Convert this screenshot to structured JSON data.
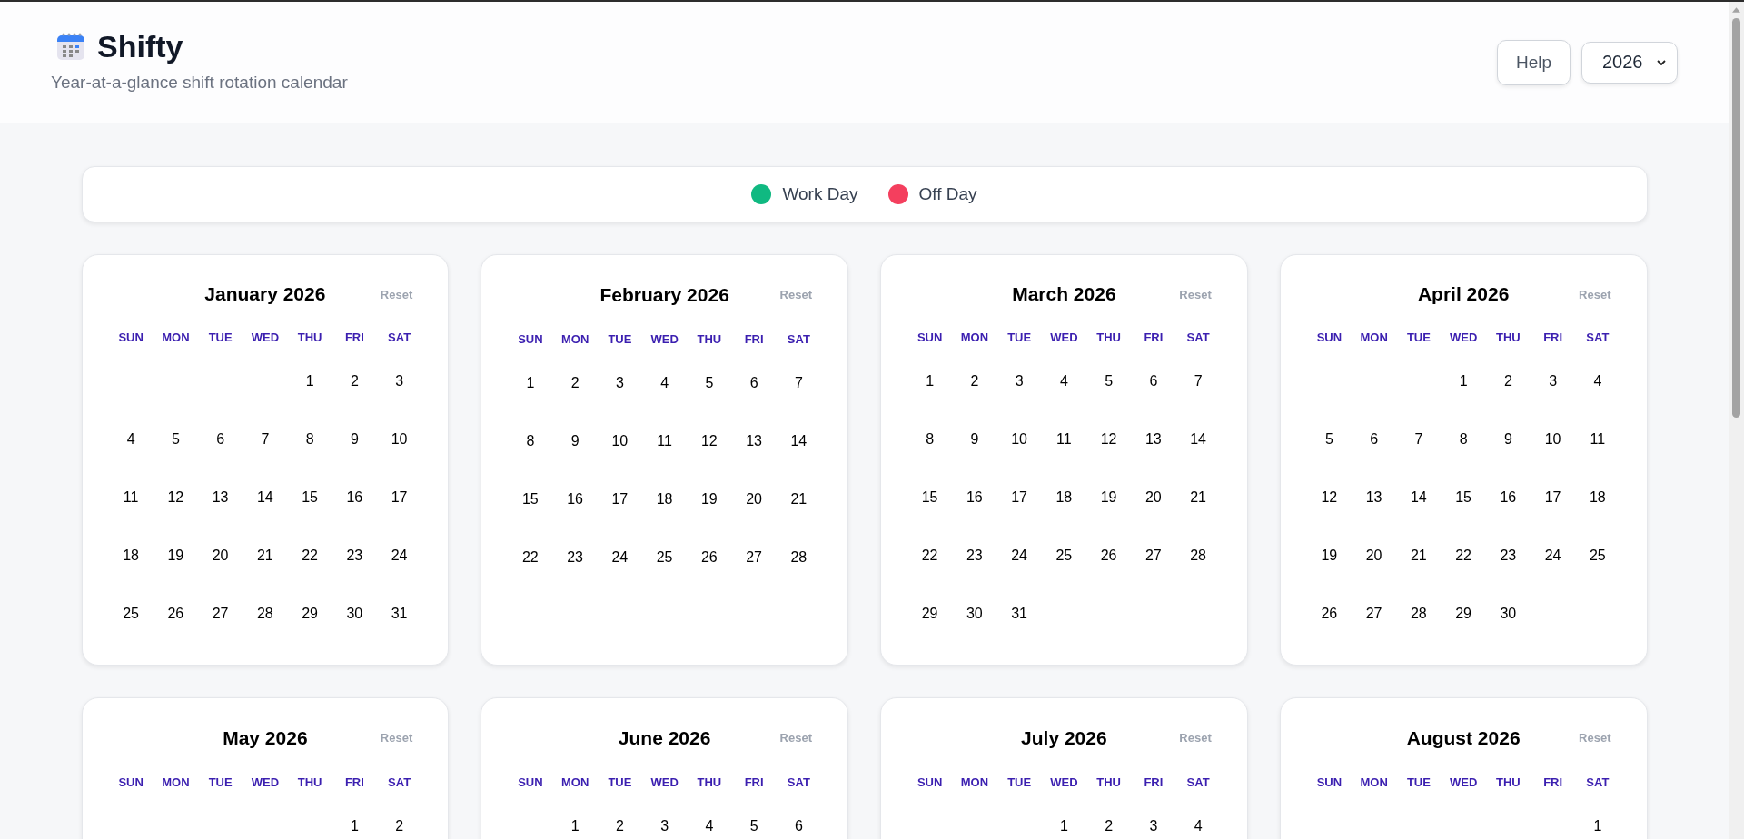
{
  "header": {
    "title": "Shifty",
    "subtitle": "Year-at-a-glance shift rotation calendar",
    "help_button": "Help",
    "year_select": {
      "value": "2026"
    }
  },
  "legend": [
    {
      "label": "Work Day",
      "color": "#10b981"
    },
    {
      "label": "Off Day",
      "color": "#f43f5e"
    }
  ],
  "months": [
    {
      "title": "January 2026",
      "reset": "Reset",
      "weekdays": [
        "SUN",
        "MON",
        "TUE",
        "WED",
        "THU",
        "FRI",
        "SAT"
      ],
      "weeks": [
        [
          {
            "kind": "blank"
          },
          {
            "kind": "blank"
          },
          {
            "kind": "blank"
          },
          {
            "kind": "blank"
          },
          {
            "kind": "day",
            "label": "1"
          },
          {
            "kind": "day",
            "label": "2"
          },
          {
            "kind": "day",
            "label": "3"
          }
        ],
        [
          {
            "kind": "day",
            "label": "4"
          },
          {
            "kind": "day",
            "label": "5"
          },
          {
            "kind": "day",
            "label": "6"
          },
          {
            "kind": "day",
            "label": "7"
          },
          {
            "kind": "day",
            "label": "8"
          },
          {
            "kind": "day",
            "label": "9"
          },
          {
            "kind": "day",
            "label": "10"
          }
        ],
        [
          {
            "kind": "day",
            "label": "11"
          },
          {
            "kind": "day",
            "label": "12"
          },
          {
            "kind": "day",
            "label": "13"
          },
          {
            "kind": "day",
            "label": "14"
          },
          {
            "kind": "day",
            "label": "15"
          },
          {
            "kind": "day",
            "label": "16"
          },
          {
            "kind": "day",
            "label": "17"
          }
        ],
        [
          {
            "kind": "day",
            "label": "18"
          },
          {
            "kind": "day",
            "label": "19"
          },
          {
            "kind": "day",
            "label": "20"
          },
          {
            "kind": "day",
            "label": "21"
          },
          {
            "kind": "day",
            "label": "22"
          },
          {
            "kind": "day",
            "label": "23"
          },
          {
            "kind": "day",
            "label": "24"
          }
        ],
        [
          {
            "kind": "day",
            "label": "25"
          },
          {
            "kind": "day",
            "label": "26"
          },
          {
            "kind": "day",
            "label": "27"
          },
          {
            "kind": "day",
            "label": "28"
          },
          {
            "kind": "day",
            "label": "29"
          },
          {
            "kind": "day",
            "label": "30"
          },
          {
            "kind": "day",
            "label": "31"
          }
        ]
      ]
    },
    {
      "title": "February 2026",
      "reset": "Reset",
      "weekdays": [
        "SUN",
        "MON",
        "TUE",
        "WED",
        "THU",
        "FRI",
        "SAT"
      ],
      "weeks": [
        [
          {
            "kind": "day",
            "label": "1"
          },
          {
            "kind": "day",
            "label": "2"
          },
          {
            "kind": "day",
            "label": "3"
          },
          {
            "kind": "day",
            "label": "4"
          },
          {
            "kind": "day",
            "label": "5"
          },
          {
            "kind": "day",
            "label": "6"
          },
          {
            "kind": "day",
            "label": "7"
          }
        ],
        [
          {
            "kind": "day",
            "label": "8"
          },
          {
            "kind": "day",
            "label": "9"
          },
          {
            "kind": "day",
            "label": "10"
          },
          {
            "kind": "day",
            "label": "11"
          },
          {
            "kind": "day",
            "label": "12"
          },
          {
            "kind": "day",
            "label": "13"
          },
          {
            "kind": "day",
            "label": "14"
          }
        ],
        [
          {
            "kind": "day",
            "label": "15"
          },
          {
            "kind": "day",
            "label": "16"
          },
          {
            "kind": "day",
            "label": "17"
          },
          {
            "kind": "day",
            "label": "18"
          },
          {
            "kind": "day",
            "label": "19"
          },
          {
            "kind": "day",
            "label": "20"
          },
          {
            "kind": "day",
            "label": "21"
          }
        ],
        [
          {
            "kind": "day",
            "label": "22"
          },
          {
            "kind": "day",
            "label": "23"
          },
          {
            "kind": "day",
            "label": "24"
          },
          {
            "kind": "day",
            "label": "25"
          },
          {
            "kind": "day",
            "label": "26"
          },
          {
            "kind": "day",
            "label": "27"
          },
          {
            "kind": "day",
            "label": "28"
          }
        ]
      ]
    },
    {
      "title": "March 2026",
      "reset": "Reset",
      "weekdays": [
        "SUN",
        "MON",
        "TUE",
        "WED",
        "THU",
        "FRI",
        "SAT"
      ],
      "weeks": [
        [
          {
            "kind": "day",
            "label": "1"
          },
          {
            "kind": "day",
            "label": "2"
          },
          {
            "kind": "day",
            "label": "3"
          },
          {
            "kind": "day",
            "label": "4"
          },
          {
            "kind": "day",
            "label": "5"
          },
          {
            "kind": "day",
            "label": "6"
          },
          {
            "kind": "day",
            "label": "7"
          }
        ],
        [
          {
            "kind": "day",
            "label": "8"
          },
          {
            "kind": "day",
            "label": "9"
          },
          {
            "kind": "day",
            "label": "10"
          },
          {
            "kind": "day",
            "label": "11"
          },
          {
            "kind": "day",
            "label": "12"
          },
          {
            "kind": "day",
            "label": "13"
          },
          {
            "kind": "day",
            "label": "14"
          }
        ],
        [
          {
            "kind": "day",
            "label": "15"
          },
          {
            "kind": "day",
            "label": "16"
          },
          {
            "kind": "day",
            "label": "17"
          },
          {
            "kind": "day",
            "label": "18"
          },
          {
            "kind": "day",
            "label": "19"
          },
          {
            "kind": "day",
            "label": "20"
          },
          {
            "kind": "day",
            "label": "21"
          }
        ],
        [
          {
            "kind": "day",
            "label": "22"
          },
          {
            "kind": "day",
            "label": "23"
          },
          {
            "kind": "day",
            "label": "24"
          },
          {
            "kind": "day",
            "label": "25"
          },
          {
            "kind": "day",
            "label": "26"
          },
          {
            "kind": "day",
            "label": "27"
          },
          {
            "kind": "day",
            "label": "28"
          }
        ],
        [
          {
            "kind": "day",
            "label": "29"
          },
          {
            "kind": "day",
            "label": "30"
          },
          {
            "kind": "day",
            "label": "31"
          },
          {
            "kind": "blank"
          },
          {
            "kind": "blank"
          },
          {
            "kind": "blank"
          },
          {
            "kind": "blank"
          }
        ]
      ]
    },
    {
      "title": "April 2026",
      "reset": "Reset",
      "weekdays": [
        "SUN",
        "MON",
        "TUE",
        "WED",
        "THU",
        "FRI",
        "SAT"
      ],
      "weeks": [
        [
          {
            "kind": "blank"
          },
          {
            "kind": "blank"
          },
          {
            "kind": "blank"
          },
          {
            "kind": "day",
            "label": "1"
          },
          {
            "kind": "day",
            "label": "2"
          },
          {
            "kind": "day",
            "label": "3"
          },
          {
            "kind": "day",
            "label": "4"
          }
        ],
        [
          {
            "kind": "day",
            "label": "5"
          },
          {
            "kind": "day",
            "label": "6"
          },
          {
            "kind": "day",
            "label": "7"
          },
          {
            "kind": "day",
            "label": "8"
          },
          {
            "kind": "day",
            "label": "9"
          },
          {
            "kind": "day",
            "label": "10"
          },
          {
            "kind": "day",
            "label": "11"
          }
        ],
        [
          {
            "kind": "day",
            "label": "12"
          },
          {
            "kind": "day",
            "label": "13"
          },
          {
            "kind": "day",
            "label": "14"
          },
          {
            "kind": "day",
            "label": "15"
          },
          {
            "kind": "day",
            "label": "16"
          },
          {
            "kind": "day",
            "label": "17"
          },
          {
            "kind": "day",
            "label": "18"
          }
        ],
        [
          {
            "kind": "day",
            "label": "19"
          },
          {
            "kind": "day",
            "label": "20"
          },
          {
            "kind": "day",
            "label": "21"
          },
          {
            "kind": "day",
            "label": "22"
          },
          {
            "kind": "day",
            "label": "23"
          },
          {
            "kind": "day",
            "label": "24"
          },
          {
            "kind": "day",
            "label": "25"
          }
        ],
        [
          {
            "kind": "day",
            "label": "26"
          },
          {
            "kind": "day",
            "label": "27"
          },
          {
            "kind": "day",
            "label": "28"
          },
          {
            "kind": "day",
            "label": "29"
          },
          {
            "kind": "day",
            "label": "30"
          },
          {
            "kind": "blank"
          },
          {
            "kind": "blank"
          }
        ]
      ]
    },
    {
      "title": "May 2026",
      "reset": "Reset",
      "weekdays": [
        "SUN",
        "MON",
        "TUE",
        "WED",
        "THU",
        "FRI",
        "SAT"
      ],
      "weeks": [
        [
          {
            "kind": "blank"
          },
          {
            "kind": "blank"
          },
          {
            "kind": "blank"
          },
          {
            "kind": "blank"
          },
          {
            "kind": "blank"
          },
          {
            "kind": "day",
            "label": "1"
          },
          {
            "kind": "day",
            "label": "2"
          }
        ]
      ]
    },
    {
      "title": "June 2026",
      "reset": "Reset",
      "weekdays": [
        "SUN",
        "MON",
        "TUE",
        "WED",
        "THU",
        "FRI",
        "SAT"
      ],
      "weeks": [
        [
          {
            "kind": "blank"
          },
          {
            "kind": "day",
            "label": "1"
          },
          {
            "kind": "day",
            "label": "2"
          },
          {
            "kind": "day",
            "label": "3"
          },
          {
            "kind": "day",
            "label": "4"
          },
          {
            "kind": "day",
            "label": "5"
          },
          {
            "kind": "day",
            "label": "6"
          }
        ]
      ]
    },
    {
      "title": "July 2026",
      "reset": "Reset",
      "weekdays": [
        "SUN",
        "MON",
        "TUE",
        "WED",
        "THU",
        "FRI",
        "SAT"
      ],
      "weeks": [
        [
          {
            "kind": "blank"
          },
          {
            "kind": "blank"
          },
          {
            "kind": "blank"
          },
          {
            "kind": "day",
            "label": "1"
          },
          {
            "kind": "day",
            "label": "2"
          },
          {
            "kind": "day",
            "label": "3"
          },
          {
            "kind": "day",
            "label": "4"
          }
        ]
      ]
    },
    {
      "title": "August 2026",
      "reset": "Reset",
      "weekdays": [
        "SUN",
        "MON",
        "TUE",
        "WED",
        "THU",
        "FRI",
        "SAT"
      ],
      "weeks": [
        [
          {
            "kind": "blank"
          },
          {
            "kind": "blank"
          },
          {
            "kind": "blank"
          },
          {
            "kind": "blank"
          },
          {
            "kind": "blank"
          },
          {
            "kind": "blank"
          },
          {
            "kind": "day",
            "label": "1"
          }
        ]
      ]
    }
  ]
}
